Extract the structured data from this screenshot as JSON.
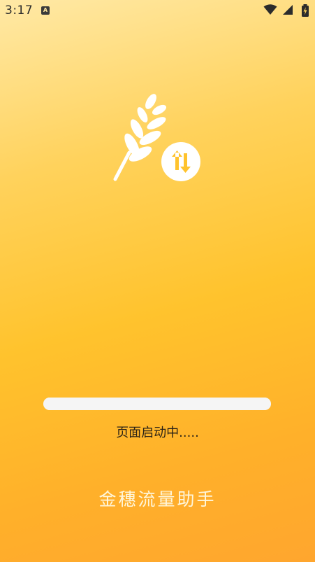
{
  "status_bar": {
    "time": "3:17",
    "notification_badge": "A",
    "icons": [
      "wifi-icon",
      "signal-icon",
      "battery-charging-icon"
    ]
  },
  "logo": {
    "icon": "wheat-transfer-logo",
    "brand_color": "#FFC32D"
  },
  "progress": {
    "value": 1.0
  },
  "loading_text": "页面启动中.....",
  "brand_name": "金穗流量助手"
}
